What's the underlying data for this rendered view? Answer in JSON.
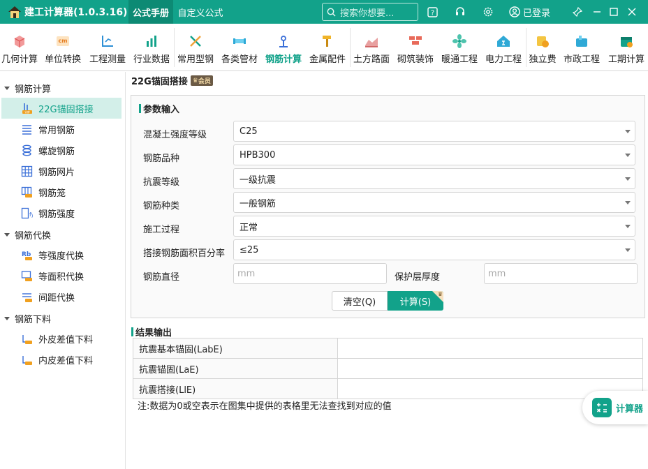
{
  "titlebar": {
    "app_title": "建工计算器(1.0.3.16)",
    "tabs": [
      "公式手册",
      "自定义公式"
    ],
    "search_placeholder": "搜索你想要...",
    "login": "已登录"
  },
  "toolbar": {
    "items": [
      "几何计算",
      "单位转换",
      "工程测量",
      "行业数据",
      "常用型钢",
      "各类管材",
      "钢筋计算",
      "金属配件",
      "土方路面",
      "砌筑装饰",
      "暖通工程",
      "电力工程",
      "独立费",
      "市政工程",
      "工期计算"
    ],
    "active": "钢筋计算"
  },
  "sidebar": {
    "groups": [
      {
        "label": "钢筋计算",
        "items": [
          "22G锚固搭接",
          "常用钢筋",
          "螺旋钢筋",
          "钢筋网片",
          "钢筋笼",
          "钢筋强度"
        ]
      },
      {
        "label": "钢筋代换",
        "items": [
          "等强度代换",
          "等面积代换",
          "间距代换"
        ]
      },
      {
        "label": "钢筋下料",
        "items": [
          "外皮差值下料",
          "内皮差值下料"
        ]
      }
    ],
    "active_item": "22G锚固搭接"
  },
  "main": {
    "page_title": "22G锚固搭接",
    "vip_badge": "会员",
    "params_title": "参数输入",
    "params": [
      {
        "label": "混凝土强度等级",
        "value": "C25"
      },
      {
        "label": "钢筋品种",
        "value": "HPB300"
      },
      {
        "label": "抗震等级",
        "value": "一级抗震"
      },
      {
        "label": "钢筋种类",
        "value": "一般钢筋"
      },
      {
        "label": "施工过程",
        "value": "正常"
      },
      {
        "label": "搭接钢筋面积百分率",
        "value": "≤25"
      }
    ],
    "diameter_label": "钢筋直径",
    "diameter_placeholder": "mm",
    "cover_label": "保护层厚度",
    "cover_placeholder": "mm",
    "clear_button": "清空(Q)",
    "calc_button": "计算(S)",
    "result_title": "结果输出",
    "results": [
      {
        "label": "抗震基本锚固(LabE)",
        "value": ""
      },
      {
        "label": "抗震锚固(LaE)",
        "value": ""
      },
      {
        "label": "抗震搭接(LlE)",
        "value": ""
      }
    ],
    "note": "注:数据为0或空表示在图集中提供的表格里无法查找到对应的值"
  },
  "float_button": "计算器",
  "colors": {
    "accent": "#12a28a",
    "active_bg": "#d3efe9"
  }
}
